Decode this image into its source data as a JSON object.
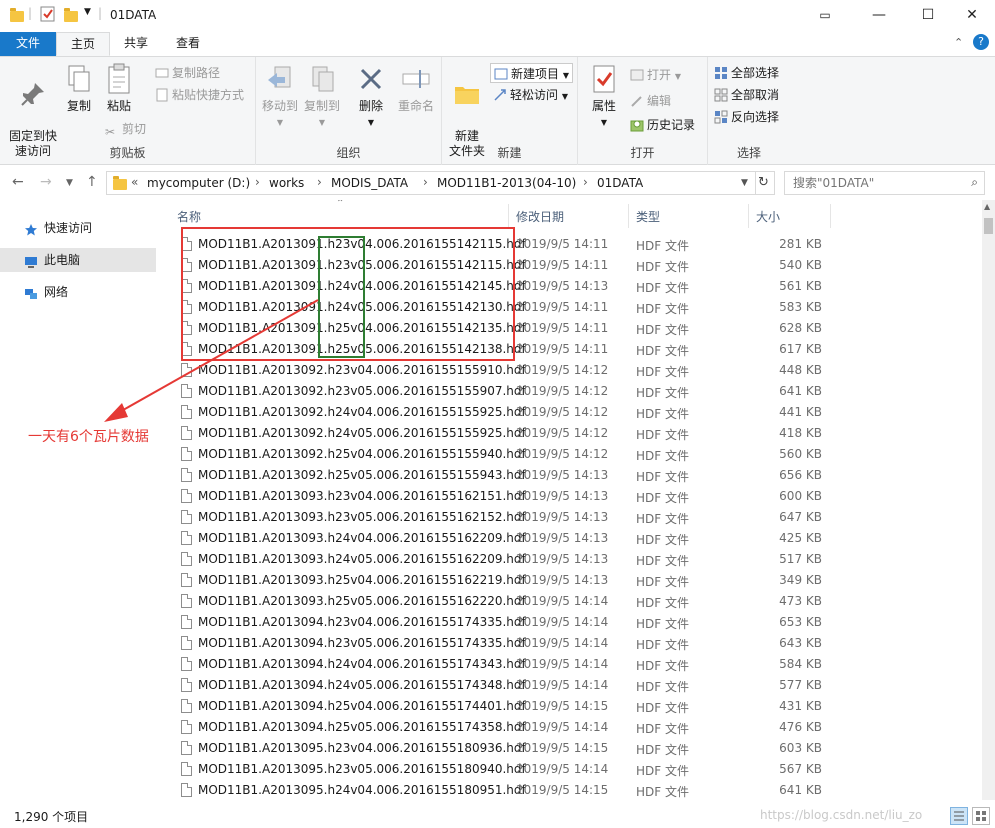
{
  "window": {
    "title": "01DATA",
    "controls": [
      "—",
      "☐",
      "✕"
    ]
  },
  "ribbon_tabs": [
    {
      "label": "文件"
    },
    {
      "label": "主页"
    },
    {
      "label": "共享"
    },
    {
      "label": "查看"
    }
  ],
  "ribbon": {
    "clipboard": {
      "label": "剪贴板",
      "pin": "固定到快\n速访问",
      "copy": "复制",
      "paste": "粘贴",
      "copy_path": "复制路径",
      "paste_shortcut": "粘贴快捷方式",
      "cut": "剪切"
    },
    "organize": {
      "label": "组织",
      "move_to": "移动到",
      "copy_to": "复制到",
      "delete": "删除",
      "rename": "重命名"
    },
    "new": {
      "label": "新建",
      "new_folder": "新建\n文件夹",
      "new_item": "新建项目",
      "easy_access": "轻松访问"
    },
    "open": {
      "label": "打开",
      "properties": "属性",
      "open": "打开",
      "edit": "编辑",
      "history": "历史记录"
    },
    "select": {
      "label": "选择",
      "select_all": "全部选择",
      "select_none": "全部取消",
      "invert": "反向选择"
    }
  },
  "address": {
    "crumbs": [
      "mycomputer (D:)",
      "works",
      "MODIS_DATA",
      "MOD11B1-2013(04-10)",
      "01DATA"
    ],
    "search_placeholder": "搜索\"01DATA\""
  },
  "nav": {
    "quick_access": "快速访问",
    "this_pc": "此电脑",
    "network": "网络"
  },
  "columns": {
    "name": "名称",
    "date": "修改日期",
    "type": "类型",
    "size": "大小"
  },
  "files": [
    {
      "name": "MOD11B1.A2013091.h23v04.006.2016155142115.hdf",
      "date": "2019/9/5 14:11",
      "type": "HDF 文件",
      "size": "281 KB"
    },
    {
      "name": "MOD11B1.A2013091.h23v05.006.2016155142115.hdf",
      "date": "2019/9/5 14:11",
      "type": "HDF 文件",
      "size": "540 KB"
    },
    {
      "name": "MOD11B1.A2013091.h24v04.006.2016155142145.hdf",
      "date": "2019/9/5 14:13",
      "type": "HDF 文件",
      "size": "561 KB"
    },
    {
      "name": "MOD11B1.A2013091.h24v05.006.2016155142130.hdf",
      "date": "2019/9/5 14:11",
      "type": "HDF 文件",
      "size": "583 KB"
    },
    {
      "name": "MOD11B1.A2013091.h25v04.006.2016155142135.hdf",
      "date": "2019/9/5 14:11",
      "type": "HDF 文件",
      "size": "628 KB"
    },
    {
      "name": "MOD11B1.A2013091.h25v05.006.2016155142138.hdf",
      "date": "2019/9/5 14:11",
      "type": "HDF 文件",
      "size": "617 KB"
    },
    {
      "name": "MOD11B1.A2013092.h23v04.006.2016155155910.hdf",
      "date": "2019/9/5 14:12",
      "type": "HDF 文件",
      "size": "448 KB"
    },
    {
      "name": "MOD11B1.A2013092.h23v05.006.2016155155907.hdf",
      "date": "2019/9/5 14:12",
      "type": "HDF 文件",
      "size": "641 KB"
    },
    {
      "name": "MOD11B1.A2013092.h24v04.006.2016155155925.hdf",
      "date": "2019/9/5 14:12",
      "type": "HDF 文件",
      "size": "441 KB"
    },
    {
      "name": "MOD11B1.A2013092.h24v05.006.2016155155925.hdf",
      "date": "2019/9/5 14:12",
      "type": "HDF 文件",
      "size": "418 KB"
    },
    {
      "name": "MOD11B1.A2013092.h25v04.006.2016155155940.hdf",
      "date": "2019/9/5 14:12",
      "type": "HDF 文件",
      "size": "560 KB"
    },
    {
      "name": "MOD11B1.A2013092.h25v05.006.2016155155943.hdf",
      "date": "2019/9/5 14:13",
      "type": "HDF 文件",
      "size": "656 KB"
    },
    {
      "name": "MOD11B1.A2013093.h23v04.006.2016155162151.hdf",
      "date": "2019/9/5 14:13",
      "type": "HDF 文件",
      "size": "600 KB"
    },
    {
      "name": "MOD11B1.A2013093.h23v05.006.2016155162152.hdf",
      "date": "2019/9/5 14:13",
      "type": "HDF 文件",
      "size": "647 KB"
    },
    {
      "name": "MOD11B1.A2013093.h24v04.006.2016155162209.hdf",
      "date": "2019/9/5 14:13",
      "type": "HDF 文件",
      "size": "425 KB"
    },
    {
      "name": "MOD11B1.A2013093.h24v05.006.2016155162209.hdf",
      "date": "2019/9/5 14:13",
      "type": "HDF 文件",
      "size": "517 KB"
    },
    {
      "name": "MOD11B1.A2013093.h25v04.006.2016155162219.hdf",
      "date": "2019/9/5 14:13",
      "type": "HDF 文件",
      "size": "349 KB"
    },
    {
      "name": "MOD11B1.A2013093.h25v05.006.2016155162220.hdf",
      "date": "2019/9/5 14:14",
      "type": "HDF 文件",
      "size": "473 KB"
    },
    {
      "name": "MOD11B1.A2013094.h23v04.006.2016155174335.hdf",
      "date": "2019/9/5 14:14",
      "type": "HDF 文件",
      "size": "653 KB"
    },
    {
      "name": "MOD11B1.A2013094.h23v05.006.2016155174335.hdf",
      "date": "2019/9/5 14:14",
      "type": "HDF 文件",
      "size": "643 KB"
    },
    {
      "name": "MOD11B1.A2013094.h24v04.006.2016155174343.hdf",
      "date": "2019/9/5 14:14",
      "type": "HDF 文件",
      "size": "584 KB"
    },
    {
      "name": "MOD11B1.A2013094.h24v05.006.2016155174348.hdf",
      "date": "2019/9/5 14:14",
      "type": "HDF 文件",
      "size": "577 KB"
    },
    {
      "name": "MOD11B1.A2013094.h25v04.006.2016155174401.hdf",
      "date": "2019/9/5 14:15",
      "type": "HDF 文件",
      "size": "431 KB"
    },
    {
      "name": "MOD11B1.A2013094.h25v05.006.2016155174358.hdf",
      "date": "2019/9/5 14:14",
      "type": "HDF 文件",
      "size": "476 KB"
    },
    {
      "name": "MOD11B1.A2013095.h23v04.006.2016155180936.hdf",
      "date": "2019/9/5 14:15",
      "type": "HDF 文件",
      "size": "603 KB"
    },
    {
      "name": "MOD11B1.A2013095.h23v05.006.2016155180940.hdf",
      "date": "2019/9/5 14:14",
      "type": "HDF 文件",
      "size": "567 KB"
    },
    {
      "name": "MOD11B1.A2013095.h24v04.006.2016155180951.hdf",
      "date": "2019/9/5 14:15",
      "type": "HDF 文件",
      "size": "641 KB"
    }
  ],
  "status": {
    "count": "1,290 个项目",
    "watermark": "https://blog.csdn.net/liu_zo"
  },
  "annotation": {
    "text": "一天有6个瓦片数据",
    "red_color": "#e53935",
    "green_color": "#2e7d32"
  },
  "colors": {
    "accent": "#1979ca",
    "folder": "#f5c542"
  }
}
